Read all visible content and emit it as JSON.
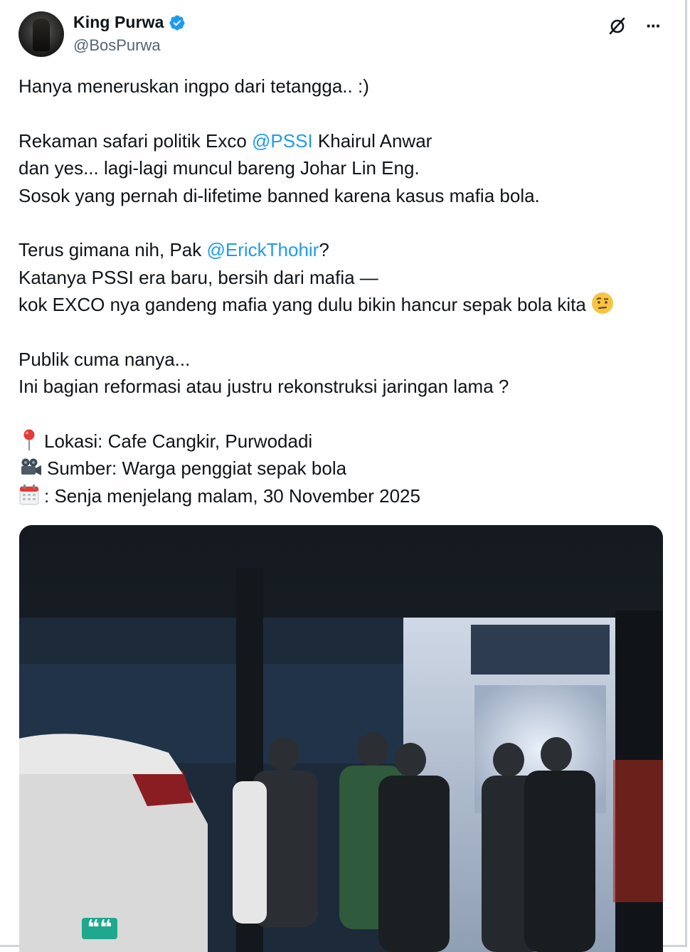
{
  "author": {
    "name": "King Purwa",
    "handle": "@BosPurwa",
    "verified": true
  },
  "header_icons": [
    "grok-icon",
    "more-icon"
  ],
  "more_glyph": "···",
  "tweet": {
    "line1": "Hanya meneruskan ingpo dari tetangga.. :)",
    "line2_pre": "Rekaman safari politik Exco ",
    "line2_mention": "@PSSI",
    "line2_post": " Khairul Anwar",
    "line3": "dan yes... lagi-lagi muncul bareng Johar Lin Eng.",
    "line4": "Sosok yang pernah di-lifetime banned karena kasus mafia bola.",
    "line5_pre": "Terus gimana nih, Pak ",
    "line5_mention": "@ErickThohir",
    "line5_post": "?",
    "line6": "Katanya PSSI era baru, bersih dari mafia —",
    "line7": "kok EXCO nya gandeng mafia yang dulu bikin hancur sepak bola  kita",
    "line8": "Publik cuma nanya...",
    "line9": "Ini bagian reformasi atau justru rekonstruksi jaringan lama ?",
    "loc": "Lokasi: Cafe Cangkir, Purwodadi",
    "src": "Sumber: Warga penggiat sepak bola",
    "date": ": Senja menjelang malam, 30 November 2025"
  },
  "icons": {
    "line7": "raised-eyebrow-emoji-icon",
    "loc": "round-pushpin-icon",
    "src": "movie-camera-icon",
    "date": "calendar-icon"
  },
  "colors": {
    "mention": "#1d9bf0",
    "verified": "#1d9bf0",
    "text": "#0f1419",
    "secondary": "#536471",
    "badge": "#1fa88d"
  },
  "media": {
    "badge_text": "❝❝"
  }
}
